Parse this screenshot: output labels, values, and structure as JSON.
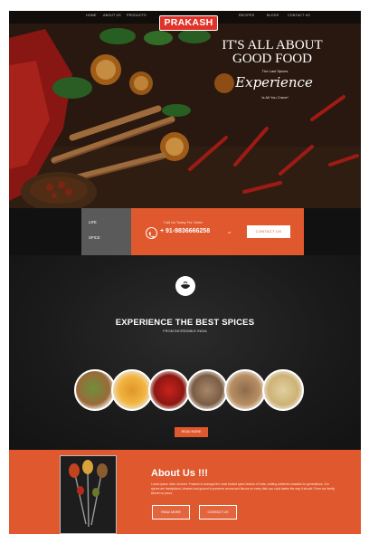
{
  "nav": {
    "logo": "PRAKASH",
    "links": [
      "HOME",
      "ABOUT US",
      "PRODUCTS",
      "",
      "",
      "",
      "",
      "RECIPES",
      "BLOGS",
      "CONTACT US"
    ]
  },
  "hero": {
    "title": "IT'S ALL ABOUT GOOD FOOD",
    "kicker": "The Last Spices",
    "script": "Experience",
    "subtitle": "Is All You Crave!"
  },
  "contact_bar": {
    "gray_lines": [
      "LIFE",
      "",
      "SPICE"
    ],
    "call_label": "Call Us Today For Order",
    "phone": "+ 91-9836666258",
    "or": "or",
    "button": "CONTACT US"
  },
  "spices_section": {
    "title": "EXPERIENCE THE BEST SPICES",
    "subtitle": "FROM INCREDIBLE INDIA",
    "items": [
      "spice-1",
      "spice-2",
      "spice-3",
      "spice-4",
      "spice-5",
      "spice-6"
    ],
    "readmore": "READ MORE"
  },
  "about": {
    "title": "About Us !!!",
    "body": "Lorem ipsum dolor sit amet. Prakash is amongst the most trusted spice brands of India, crafting authentic masalas for generations. Our spices are handpicked, cleaned and ground to preserve aroma and flavour so every dish you cook tastes the way it should. From our family kitchen to yours.",
    "buttons": [
      "READ MORE",
      "CONTACT US"
    ]
  },
  "colors": {
    "accent": "#e0582e",
    "logo_red": "#e0342a",
    "gray": "#5a5a5a"
  }
}
